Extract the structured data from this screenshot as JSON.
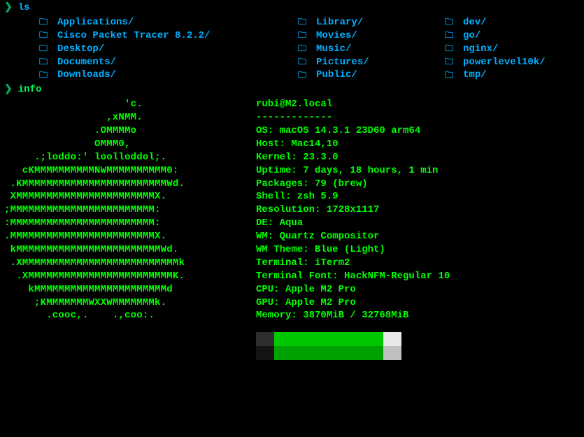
{
  "prompt_symbol": "❯",
  "commands": {
    "ls": "ls",
    "info": "info"
  },
  "ls": {
    "col1": [
      "Applications/",
      "Cisco Packet Tracer 8.2.2/",
      "Desktop/",
      "Documents/",
      "Downloads/"
    ],
    "col2": [
      "Library/",
      "Movies/",
      "Music/",
      "Pictures/",
      "Public/"
    ],
    "col3": [
      "dev/",
      "go/",
      "nginx/",
      "powerlevel10k/",
      "tmp/"
    ]
  },
  "ascii": [
    "                    'c.          ",
    "                 ,xNMM.          ",
    "               .OMMMMo           ",
    "               OMMM0,            ",
    "     .;loddo:' loolloddol;.      ",
    "   cKMMMMMMMMMMNWMMMMMMMMMM0:    ",
    " .KMMMMMMMMMMMMMMMMMMMMMMMMWd.   ",
    " XMMMMMMMMMMMMMMMMMMMMMMMX.      ",
    ";MMMMMMMMMMMMMMMMMMMMMMMM:       ",
    ":MMMMMMMMMMMMMMMMMMMMMMMM:       ",
    ".MMMMMMMMMMMMMMMMMMMMMMMMX.      ",
    " kMMMMMMMMMMMMMMMMMMMMMMMMWd.    ",
    " .XMMMMMMMMMMMMMMMMMMMMMMMMMMk   ",
    "  .XMMMMMMMMMMMMMMMMMMMMMMMMK.   ",
    "    kMMMMMMMMMMMMMMMMMMMMMMd     ",
    "     ;KMMMMMMMWXXWMMMMMMMk.      ",
    "       .cooc,.    .,coo:.        "
  ],
  "neofetch": {
    "user_host": "rubi@M2.local",
    "separator": "-------------",
    "rows": [
      "OS: macOS 14.3.1 23D60 arm64",
      "Host: Mac14,10",
      "Kernel: 23.3.0",
      "Uptime: 7 days, 18 hours, 1 min",
      "Packages: 79 (brew)",
      "Shell: zsh 5.9",
      "Resolution: 1728x1117",
      "DE: Aqua",
      "WM: Quartz Compositor",
      "WM Theme: Blue (Light)",
      "Terminal: iTerm2",
      "Terminal Font: HackNFM-Regular 10",
      "CPU: Apple M2 Pro",
      "GPU: Apple M2 Pro",
      "Memory: 3870MiB / 32768MiB"
    ]
  }
}
